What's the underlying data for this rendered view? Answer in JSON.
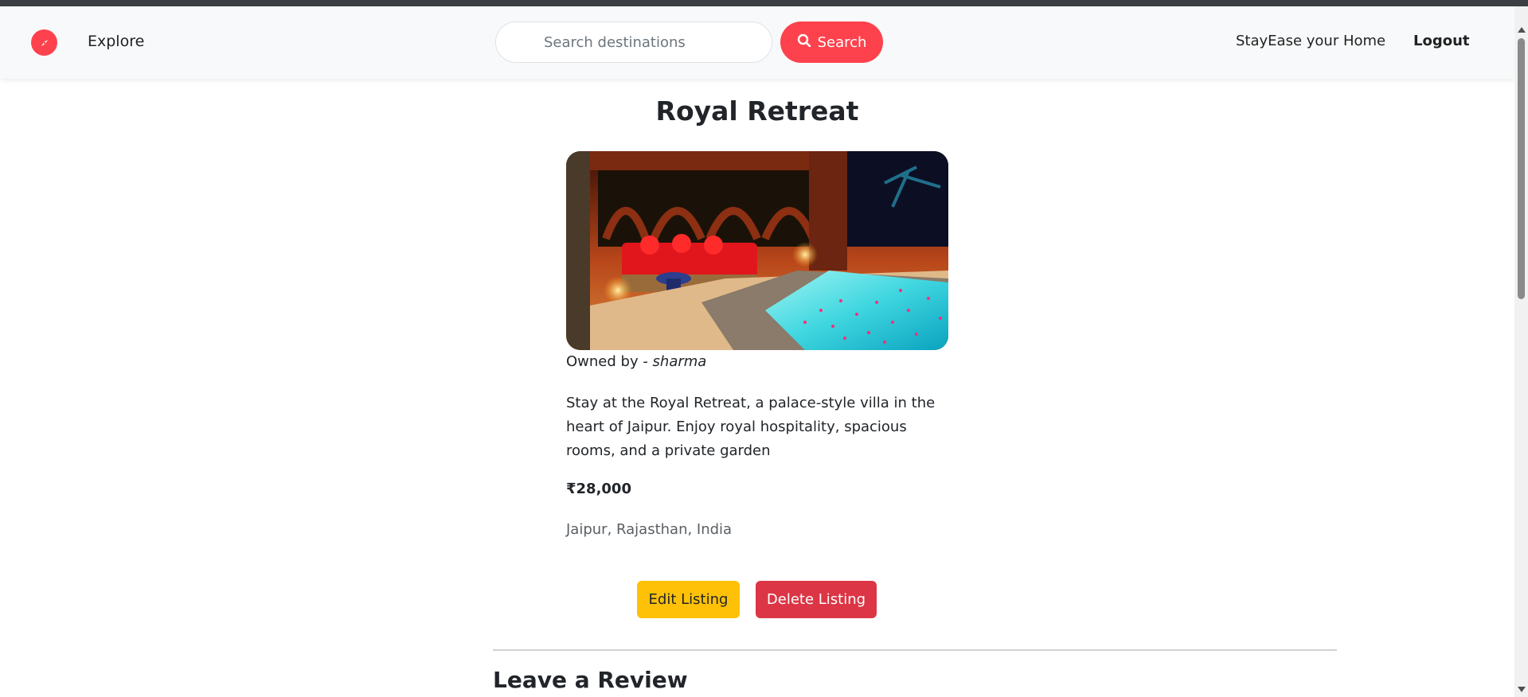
{
  "nav": {
    "brand_icon": "compass-icon",
    "explore_label": "Explore",
    "search": {
      "placeholder": "Search destinations",
      "value": "",
      "button_label": "Search",
      "button_icon": "search-icon"
    },
    "host_label": "StayEase your Home",
    "logout_label": "Logout"
  },
  "listing": {
    "title": "Royal Retreat",
    "owner_prefix": "Owned by - ",
    "owner_name": "sharma",
    "description": "Stay at the Royal Retreat, a palace-style villa in the heart of Jaipur. Enjoy royal hospitality, spacious rooms, and a private garden",
    "price": "₹28,000",
    "location": "Jaipur, Rajasthan, India"
  },
  "actions": {
    "edit_label": "Edit Listing",
    "delete_label": "Delete Listing"
  },
  "reviews": {
    "heading": "Leave a Review"
  },
  "colors": {
    "brand": "#fe424d",
    "edit": "#ffc107",
    "delete": "#dc3545"
  }
}
